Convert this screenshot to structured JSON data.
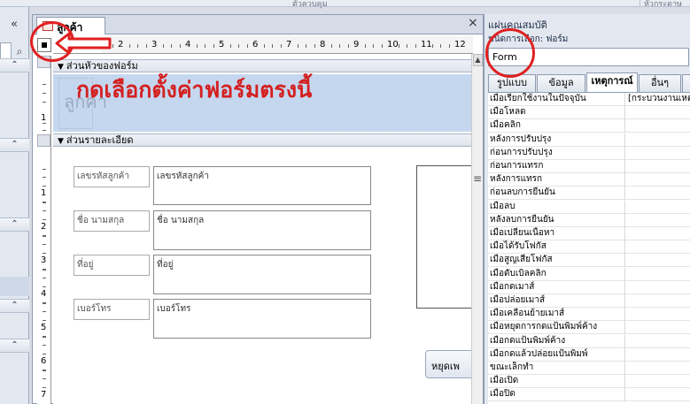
{
  "ribbon": {
    "group_label": "ตัวควบคุม",
    "group_label_2": "หัวกระดาษ"
  },
  "nav": {
    "collapse_icon": "double-chevron-left-icon",
    "group_icon": "double-chevron-up-icon",
    "search_icon": "search-icon"
  },
  "design": {
    "tab_title": "ลูกค้า",
    "close_glyph": "×",
    "ruler_numbers": [
      "1",
      "2",
      "3",
      "4",
      "5",
      "6",
      "7",
      "8",
      "9",
      "10",
      "11",
      "12"
    ],
    "vruler_header_numbers": [
      "1"
    ],
    "vruler_detail_numbers": [
      "1",
      "2",
      "3",
      "4",
      "5",
      "6",
      "7"
    ],
    "sections": {
      "header": "ส่วนหัวของฟอร์ม",
      "detail": "ส่วนรายละเอียด"
    },
    "header_label": "ลูกค้า",
    "fields": [
      {
        "label": "เลขรหัสลูกค้า",
        "value": "เลขรหัสลูกค้า"
      },
      {
        "label": "ชื่อ นามสกุล",
        "value": "ชื่อ นามสกุล"
      },
      {
        "label": "ที่อยู่",
        "value": "ที่อยู่"
      },
      {
        "label": "เบอร์โทร",
        "value": "เบอร์โทร"
      }
    ],
    "stop_button": "หยุดเพ",
    "splitter_glyph": "≡"
  },
  "annotation": {
    "text": "กดเลือกตั้งค่าฟอร์มตรงนี้",
    "color": "#d42020"
  },
  "props": {
    "title": "แผ่นคุณสมบัติ",
    "selection_type": "ชนิดการเลือก:  ฟอร์ม",
    "combo_value": "Form",
    "tabs": [
      "รูปแบบ",
      "ข้อมูล",
      "เหตุการณ์",
      "อื่นๆ",
      "ทั้งหมด"
    ],
    "active_tab": "เหตุการณ์",
    "rows": [
      {
        "name": "เมื่อเรียกใช้งานในปัจจุบัน",
        "value": "[กระบวนงานเหตุ"
      },
      {
        "name": "เมื่อโหลด",
        "value": ""
      },
      {
        "name": "เมื่อคลิก",
        "value": ""
      },
      {
        "name": "หลังการปรับปรุง",
        "value": ""
      },
      {
        "name": "ก่อนการปรับปรุง",
        "value": ""
      },
      {
        "name": "ก่อนการแทรก",
        "value": ""
      },
      {
        "name": "หลังการแทรก",
        "value": ""
      },
      {
        "name": "ก่อนลบการยืนยัน",
        "value": ""
      },
      {
        "name": "เมื่อลบ",
        "value": ""
      },
      {
        "name": "หลังลบการยืนยัน",
        "value": ""
      },
      {
        "name": "เมื่อเปลี่ยนเนื้อหา",
        "value": ""
      },
      {
        "name": "เมื่อได้รับโฟกัส",
        "value": ""
      },
      {
        "name": "เมื่อสูญเสียโฟกัส",
        "value": ""
      },
      {
        "name": "เมื่อดับเบิลคลิก",
        "value": ""
      },
      {
        "name": "เมื่อกดเมาส์",
        "value": ""
      },
      {
        "name": "เมื่อปล่อยเมาส์",
        "value": ""
      },
      {
        "name": "เมื่อเคลื่อนย้ายเมาส์",
        "value": ""
      },
      {
        "name": "เมื่อหยุดการกดแป้นพิมพ์ค้าง",
        "value": ""
      },
      {
        "name": "เมื่อกดแป้นพิมพ์ค้าง",
        "value": ""
      },
      {
        "name": "เมื่อกดแล้วปล่อยแป้นพิมพ์",
        "value": ""
      },
      {
        "name": "ขณะเล็กทำ",
        "value": ""
      },
      {
        "name": "เมื่อเปิด",
        "value": ""
      },
      {
        "name": "เมื่อปิด",
        "value": ""
      }
    ]
  }
}
